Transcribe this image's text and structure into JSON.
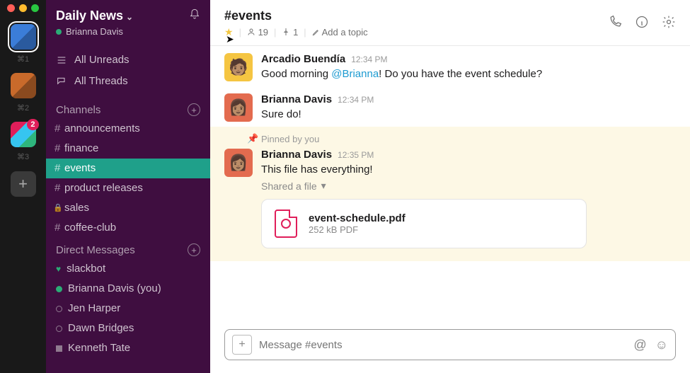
{
  "rail": {
    "workspaces": [
      {
        "shortcut": "⌘1",
        "badge": null,
        "active": true
      },
      {
        "shortcut": "⌘2",
        "badge": null,
        "active": false
      },
      {
        "shortcut": "⌘3",
        "badge": "2",
        "active": false
      }
    ]
  },
  "sidebar": {
    "workspace_name": "Daily News",
    "current_user": "Brianna Davis",
    "all_unreads": "All Unreads",
    "all_threads": "All Threads",
    "channels_heading": "Channels",
    "channels": [
      {
        "name": "announcements",
        "active": false,
        "private": false
      },
      {
        "name": "finance",
        "active": false,
        "private": false
      },
      {
        "name": "events",
        "active": true,
        "private": false
      },
      {
        "name": "product releases",
        "active": false,
        "private": false
      },
      {
        "name": "sales",
        "active": false,
        "private": true
      },
      {
        "name": "coffee-club",
        "active": false,
        "private": false
      }
    ],
    "dm_heading": "Direct Messages",
    "dms": [
      {
        "name": "slackbot",
        "presence": "heart"
      },
      {
        "name": "Brianna Davis (you)",
        "presence": "on"
      },
      {
        "name": "Jen Harper",
        "presence": "off"
      },
      {
        "name": "Dawn Bridges",
        "presence": "off"
      },
      {
        "name": "Kenneth Tate",
        "presence": "sq"
      }
    ]
  },
  "channel_header": {
    "name": "#events",
    "starred": true,
    "member_count": "19",
    "pin_count": "1",
    "topic_placeholder": "Add a topic"
  },
  "messages": [
    {
      "author": "Arcadio Buendía",
      "time": "12:34 PM",
      "text_pre": "Good morning ",
      "mention": "@Brianna",
      "text_post": "! Do you have the event schedule?",
      "avatar": "av1"
    },
    {
      "author": "Brianna Davis",
      "time": "12:34 PM",
      "text": "Sure do!",
      "avatar": "av2"
    }
  ],
  "pinned": {
    "label": "Pinned by you",
    "author": "Brianna Davis",
    "time": "12:35 PM",
    "text": "This file has everything!",
    "shared_label": "Shared a file",
    "file": {
      "name": "event-schedule.pdf",
      "meta": "252 kB PDF"
    }
  },
  "composer": {
    "placeholder": "Message #events"
  }
}
